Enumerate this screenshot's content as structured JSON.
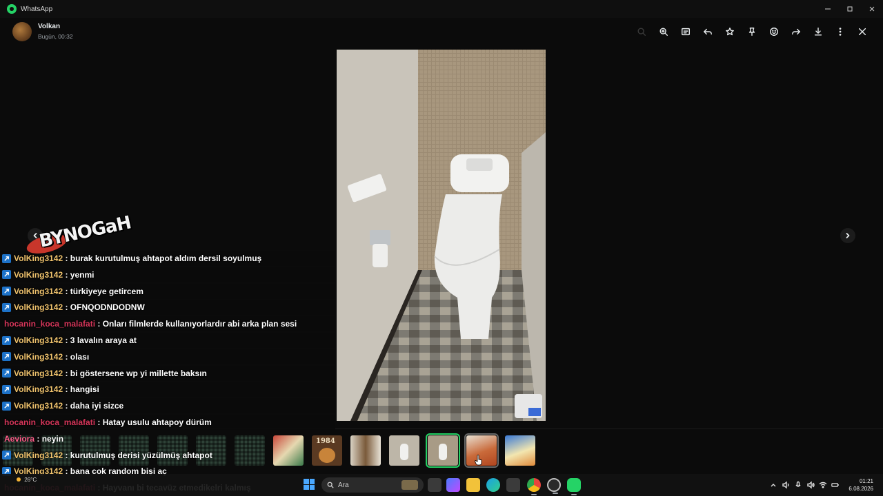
{
  "window": {
    "title": "WhatsApp"
  },
  "header": {
    "contact_name": "Volkan",
    "timestamp": "Bugün, 00:32"
  },
  "toolbar": {
    "icons": [
      "search-icon",
      "zoom-in-icon",
      "caption-icon",
      "reply-icon",
      "star-icon",
      "pin-icon",
      "emoji-icon",
      "forward-icon",
      "download-icon",
      "more-icon",
      "close-icon"
    ]
  },
  "colors": {
    "accent_green": "#25d366",
    "nick_gold": "#f0c36d",
    "nick_red": "#d6365a",
    "nick_pink": "#ff5c8a",
    "badge_blue": "#1d72c8"
  },
  "chat": {
    "lines": [
      {
        "nick": "VolKing3142",
        "badge": true,
        "color": "#f0c36d",
        "text": ": burak kurutulmuş ahtapot aldım dersil soyulmuş"
      },
      {
        "nick": "VolKing3142",
        "badge": true,
        "color": "#f0c36d",
        "text": ": yenmi"
      },
      {
        "nick": "VolKing3142",
        "badge": true,
        "color": "#f0c36d",
        "text": ": türkiyeye getircem"
      },
      {
        "nick": "VolKing3142",
        "badge": true,
        "color": "#f0c36d",
        "text": ": OFNQODNDODNW"
      },
      {
        "nick": "hocanin_koca_malafati",
        "badge": false,
        "color": "#d6365a",
        "text": ": Onları filmlerde kullanıyorlardır abi arka plan sesi"
      },
      {
        "nick": "VolKing3142",
        "badge": true,
        "color": "#f0c36d",
        "text": ": 3 lavalın araya at"
      },
      {
        "nick": "VolKing3142",
        "badge": true,
        "color": "#f0c36d",
        "text": ": olası"
      },
      {
        "nick": "VolKing3142",
        "badge": true,
        "color": "#f0c36d",
        "text": ": bi göstersene wp yi millette baksın"
      },
      {
        "nick": "VolKing3142",
        "badge": true,
        "color": "#f0c36d",
        "text": ": hangisi"
      },
      {
        "nick": "VolKing3142",
        "badge": true,
        "color": "#f0c36d",
        "text": ": daha iyi sizce"
      },
      {
        "nick": "hocanin_koca_malafati",
        "badge": false,
        "color": "#d6365a",
        "text": ": Hatay usulu ahtapoy dürüm"
      },
      {
        "nick": "Aeviora",
        "badge": false,
        "color": "#ff5c8a",
        "text": ": neyin"
      },
      {
        "nick": "VolKing3142",
        "badge": true,
        "color": "#f0c36d",
        "text": ": kurutulmuş derisi yüzülmüş ahtapot"
      },
      {
        "nick": "VolKing3142",
        "badge": true,
        "color": "#f0c36d",
        "text": ": bana cok random bişi aç"
      },
      {
        "nick": "hocanin_koca_malafati",
        "badge": false,
        "color": "#d6365a",
        "text": ": Hayvanı bi tecavüz etmedikelri kalmış"
      }
    ]
  },
  "thumbnails": {
    "count": 14,
    "selected_index": 11,
    "hover_index": 12,
    "labels": {
      "book_title": "1984"
    }
  },
  "taskbar": {
    "weather": "26°C",
    "search_placeholder": "Ara",
    "time": "01:21",
    "date": "6.08.2026"
  }
}
